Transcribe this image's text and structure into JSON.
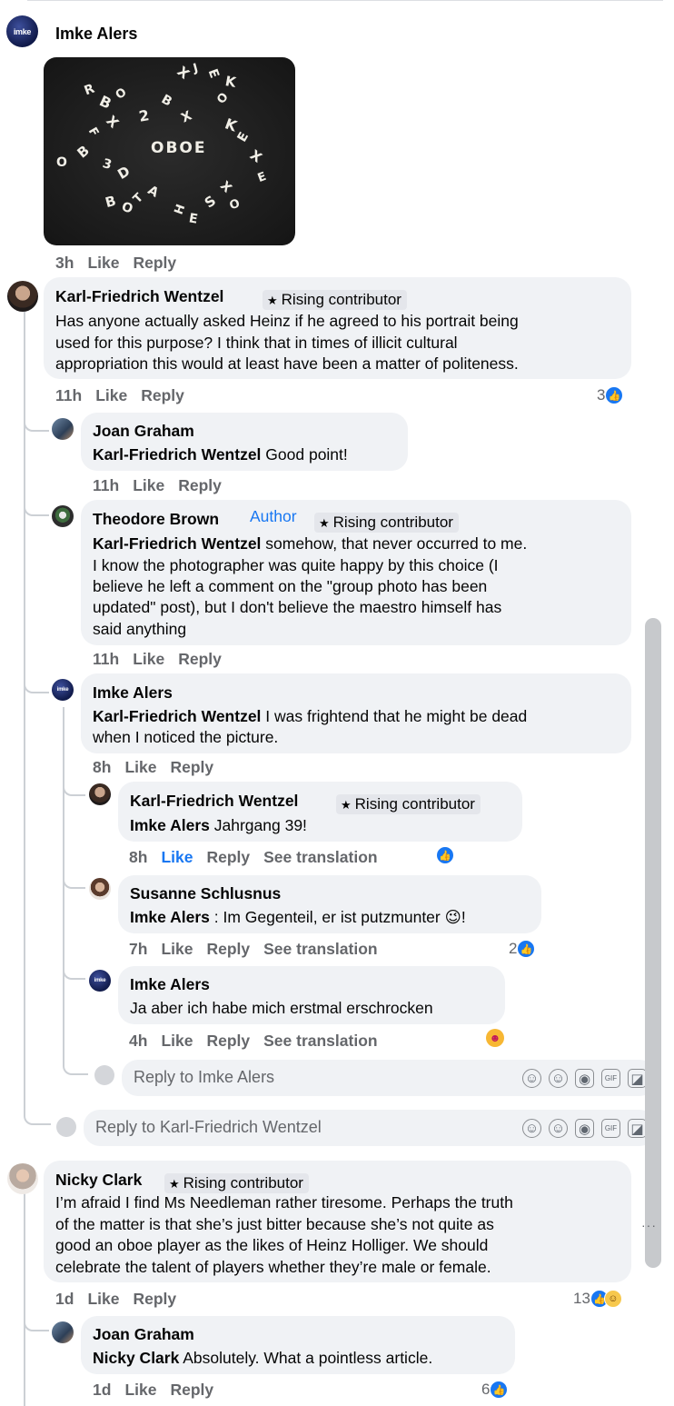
{
  "post": {
    "author": "Imke Alers",
    "avatar_text": "imke",
    "photo_word": "OBOE",
    "time": "3h",
    "like_label": "Like",
    "reply_label": "Reply"
  },
  "comments": {
    "kf": {
      "name": "Karl-Friedrich Wentzel",
      "badge": "Rising contributor",
      "lines": [
        "Has anyone actually asked Heinz if he agreed to his portrait being",
        "used for this purpose? I think that in times of illicit cultural",
        "appropriation this would at least have been a matter of politeness."
      ],
      "time": "11h",
      "reactions": "3"
    },
    "joan1": {
      "name": "Joan Graham",
      "mention": "Karl-Friedrich Wentzel",
      "text": " Good point!",
      "time": "11h"
    },
    "theo": {
      "name": "Theodore Brown",
      "author_tag": "Author",
      "badge": "Rising contributor",
      "mention": "Karl-Friedrich Wentzel",
      "line1": " somehow, that never occurred to me.",
      "lines": [
        "I know the photographer was quite happy by this choice (I",
        "believe he left a comment on the \"group photo has been",
        "updated\" post), but I don't believe the maestro himself has",
        "said anything"
      ],
      "time": "11h"
    },
    "imke1": {
      "name": "Imke Alers",
      "mention": "Karl-Friedrich Wentzel",
      "line1": " I was frightend that he might be dead",
      "line2": "when I noticed the picture.",
      "time": "8h"
    },
    "kf2": {
      "name": "Karl-Friedrich Wentzel",
      "badge": "Rising contributor",
      "mention": "Imke Alers",
      "text": " Jahrgang 39!",
      "time": "8h",
      "see_translation": "See translation"
    },
    "susanne": {
      "name": "Susanne Schlusnus",
      "mention": "Imke Alers",
      "text": " : Im Gegenteil, er ist putzmunter ",
      "emoji": "😉",
      "end": "!",
      "time": "7h",
      "see_translation": "See translation",
      "reactions": "2"
    },
    "imke2": {
      "name": "Imke Alers",
      "text": "Ja aber ich habe mich erstmal erschrocken",
      "time": "4h",
      "see_translation": "See translation"
    },
    "nicky": {
      "name": "Nicky Clark",
      "badge": "Rising contributor",
      "lines": [
        "I’m afraid I find Ms Needleman rather tiresome. Perhaps the truth",
        "of the matter is that she’s just bitter because she’s not quite as",
        "good an oboe player as the likes of Heinz Holliger. We should",
        "celebrate the talent of players whether they’re male or female."
      ],
      "time": "1d",
      "reactions": "13"
    },
    "joan2": {
      "name": "Joan Graham",
      "mention": "Nicky Clark",
      "text": " Absolutely. What a pointless article.",
      "time": "1d",
      "reactions": "6"
    }
  },
  "reply_inputs": {
    "imke": "Reply to Imke Alers",
    "kf": "Reply to Karl-Friedrich Wentzel"
  },
  "labels": {
    "like": "Like",
    "reply": "Reply"
  },
  "colors": {
    "link_blue": "#1877f2",
    "bubble_bg": "#f0f2f5",
    "meta_gray": "#65676b"
  }
}
